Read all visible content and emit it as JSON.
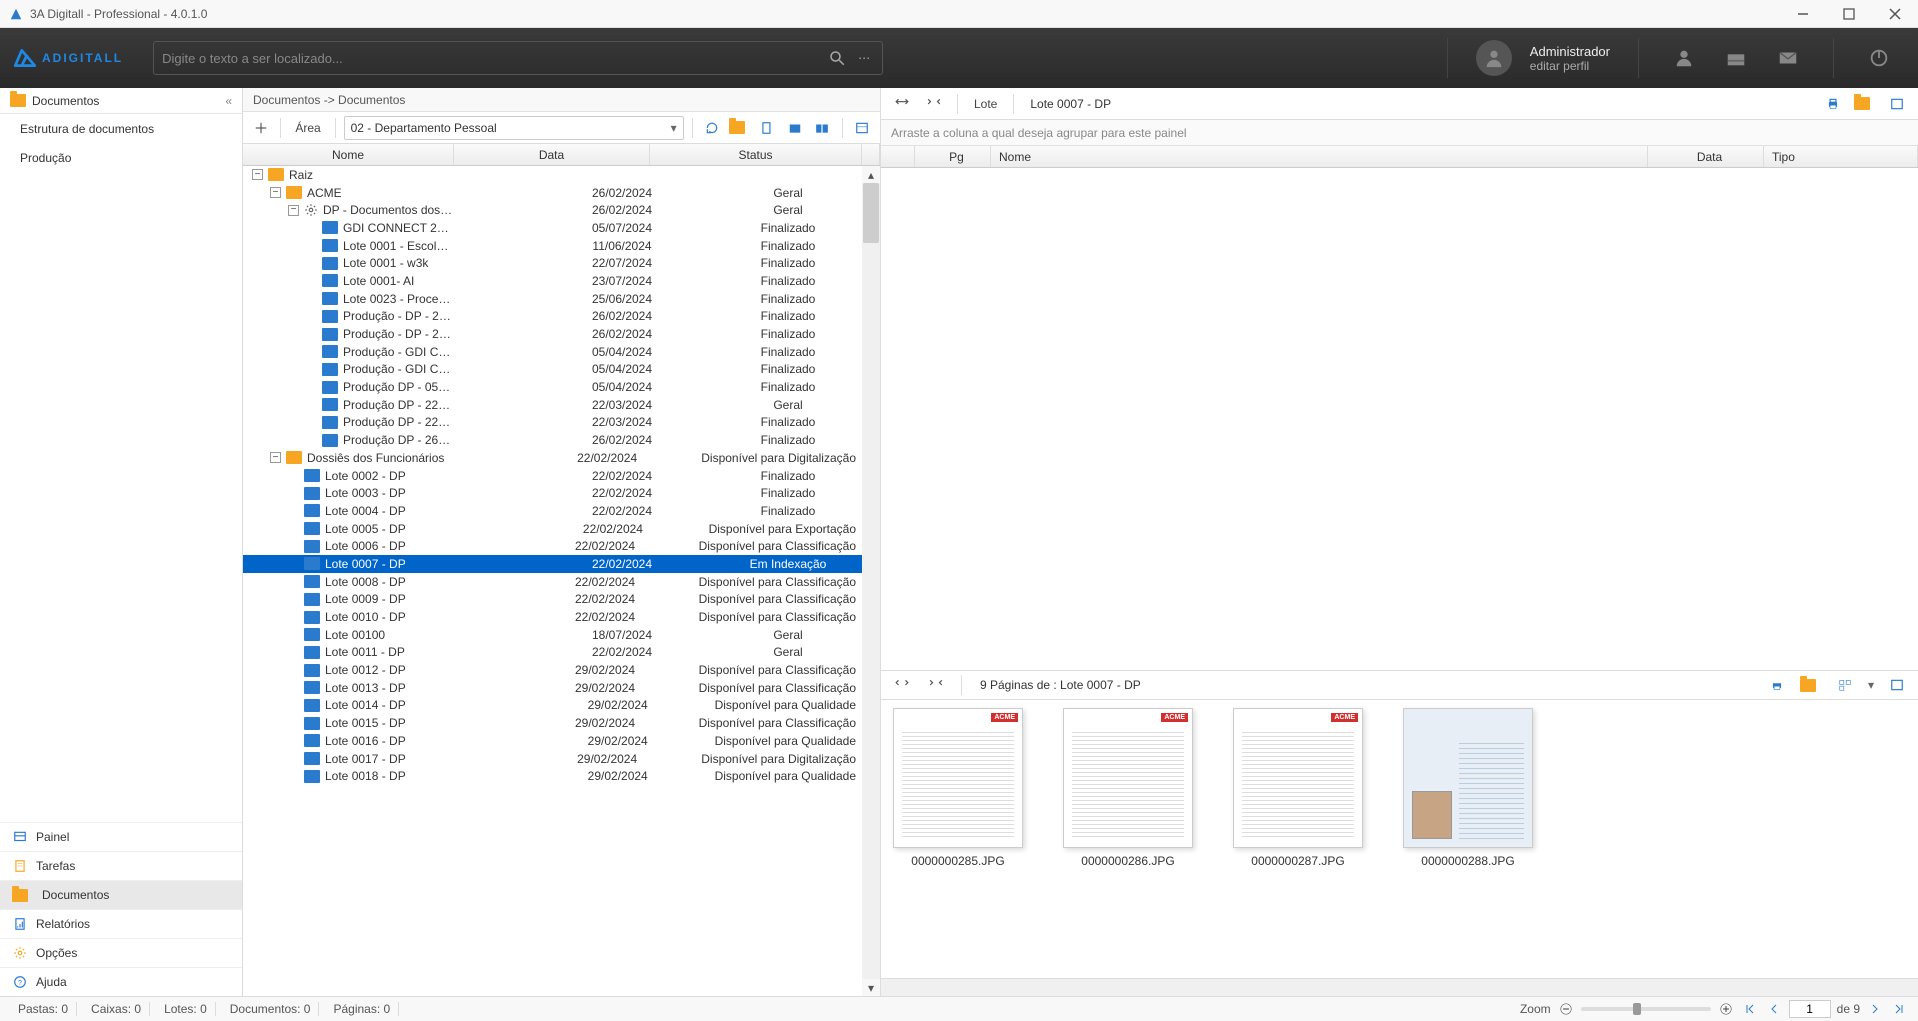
{
  "titlebar": "3A Digitall - Professional - 4.0.1.0",
  "logo": "ADIGITALL",
  "search_placeholder": "Digite o texto a ser localizado...",
  "user": {
    "name": "Administrador",
    "edit": "editar perfil"
  },
  "sidebar": {
    "header": "Documentos",
    "top_items": [
      "Estrutura de documentos",
      "Produção"
    ],
    "bottom_items": [
      {
        "label": "Painel"
      },
      {
        "label": "Tarefas"
      },
      {
        "label": "Documentos",
        "active": true
      },
      {
        "label": "Relatórios"
      },
      {
        "label": "Opções"
      },
      {
        "label": "Ajuda"
      }
    ]
  },
  "breadcrumb": "Documentos -> Documentos",
  "area_label": "Área",
  "area_selected": "02 - Departamento Pessoal",
  "tree_headers": {
    "nome": "Nome",
    "data": "Data",
    "status": "Status"
  },
  "tree_rows": [
    {
      "depth": 0,
      "exp": "-",
      "ico": "yellow",
      "nome": "Raiz",
      "data": "",
      "status": ""
    },
    {
      "depth": 1,
      "exp": "-",
      "ico": "yellow",
      "nome": "ACME",
      "data": "26/02/2024",
      "status": "Geral"
    },
    {
      "depth": 2,
      "exp": "-",
      "ico": "gear",
      "nome": "DP - Documentos dos…",
      "data": "26/02/2024",
      "status": "Geral"
    },
    {
      "depth": 3,
      "exp": "",
      "ico": "blue",
      "nome": "GDI  CONNECT 2…",
      "data": "05/07/2024",
      "status": "Finalizado"
    },
    {
      "depth": 3,
      "exp": "",
      "ico": "blue",
      "nome": "Lote 0001 - Escol…",
      "data": "11/06/2024",
      "status": "Finalizado"
    },
    {
      "depth": 3,
      "exp": "",
      "ico": "blue",
      "nome": "Lote 0001 - w3k",
      "data": "22/07/2024",
      "status": "Finalizado"
    },
    {
      "depth": 3,
      "exp": "",
      "ico": "blue",
      "nome": "Lote 0001- AI",
      "data": "23/07/2024",
      "status": "Finalizado"
    },
    {
      "depth": 3,
      "exp": "",
      "ico": "blue",
      "nome": "Lote 0023 - Proce…",
      "data": "25/06/2024",
      "status": "Finalizado"
    },
    {
      "depth": 3,
      "exp": "",
      "ico": "blue",
      "nome": "Produção - DP - 2…",
      "data": "26/02/2024",
      "status": "Finalizado"
    },
    {
      "depth": 3,
      "exp": "",
      "ico": "blue",
      "nome": "Produção - DP - 2…",
      "data": "26/02/2024",
      "status": "Finalizado"
    },
    {
      "depth": 3,
      "exp": "",
      "ico": "blue",
      "nome": "Produção - GDI C…",
      "data": "05/04/2024",
      "status": "Finalizado"
    },
    {
      "depth": 3,
      "exp": "",
      "ico": "blue",
      "nome": "Produção - GDI C…",
      "data": "05/04/2024",
      "status": "Finalizado"
    },
    {
      "depth": 3,
      "exp": "",
      "ico": "blue",
      "nome": "Produção DP - 05…",
      "data": "05/04/2024",
      "status": "Finalizado"
    },
    {
      "depth": 3,
      "exp": "",
      "ico": "blue",
      "nome": "Produção DP - 22…",
      "data": "22/03/2024",
      "status": "Geral"
    },
    {
      "depth": 3,
      "exp": "",
      "ico": "blue",
      "nome": "Produção DP - 22…",
      "data": "22/03/2024",
      "status": "Finalizado"
    },
    {
      "depth": 3,
      "exp": "",
      "ico": "blue",
      "nome": "Produção DP - 26…",
      "data": "26/02/2024",
      "status": "Finalizado"
    },
    {
      "depth": 1,
      "exp": "-",
      "ico": "yellow",
      "nome": "Dossiês dos Funcionários",
      "data": "22/02/2024",
      "status": "Disponível para Digitalização"
    },
    {
      "depth": 2,
      "exp": "",
      "ico": "blue",
      "nome": "Lote 0002 - DP",
      "data": "22/02/2024",
      "status": "Finalizado"
    },
    {
      "depth": 2,
      "exp": "",
      "ico": "blue",
      "nome": "Lote 0003 - DP",
      "data": "22/02/2024",
      "status": "Finalizado"
    },
    {
      "depth": 2,
      "exp": "",
      "ico": "blue",
      "nome": "Lote 0004 - DP",
      "data": "22/02/2024",
      "status": "Finalizado"
    },
    {
      "depth": 2,
      "exp": "",
      "ico": "blue",
      "nome": "Lote 0005 - DP",
      "data": "22/02/2024",
      "status": "Disponível para Exportação"
    },
    {
      "depth": 2,
      "exp": "",
      "ico": "blue",
      "nome": "Lote 0006 - DP",
      "data": "22/02/2024",
      "status": "Disponível para Classificação"
    },
    {
      "depth": 2,
      "exp": "",
      "ico": "blue",
      "nome": "Lote 0007 - DP",
      "data": "22/02/2024",
      "status": "Em Indexação",
      "selected": true
    },
    {
      "depth": 2,
      "exp": "",
      "ico": "blue",
      "nome": "Lote 0008 - DP",
      "data": "22/02/2024",
      "status": "Disponível para Classificação"
    },
    {
      "depth": 2,
      "exp": "",
      "ico": "blue",
      "nome": "Lote 0009 - DP",
      "data": "22/02/2024",
      "status": "Disponível para Classificação"
    },
    {
      "depth": 2,
      "exp": "",
      "ico": "blue",
      "nome": "Lote 0010 - DP",
      "data": "22/02/2024",
      "status": "Disponível para Classificação"
    },
    {
      "depth": 2,
      "exp": "",
      "ico": "blue",
      "nome": "Lote 00100",
      "data": "18/07/2024",
      "status": "Geral"
    },
    {
      "depth": 2,
      "exp": "",
      "ico": "blue",
      "nome": "Lote 0011 - DP",
      "data": "22/02/2024",
      "status": "Geral"
    },
    {
      "depth": 2,
      "exp": "",
      "ico": "blue",
      "nome": "Lote 0012 - DP",
      "data": "29/02/2024",
      "status": "Disponível para Classificação"
    },
    {
      "depth": 2,
      "exp": "",
      "ico": "blue",
      "nome": "Lote 0013 - DP",
      "data": "29/02/2024",
      "status": "Disponível para Classificação"
    },
    {
      "depth": 2,
      "exp": "",
      "ico": "blue",
      "nome": "Lote 0014 - DP",
      "data": "29/02/2024",
      "status": "Disponível para Qualidade"
    },
    {
      "depth": 2,
      "exp": "",
      "ico": "blue",
      "nome": "Lote 0015 - DP",
      "data": "29/02/2024",
      "status": "Disponível para Classificação"
    },
    {
      "depth": 2,
      "exp": "",
      "ico": "blue",
      "nome": "Lote 0016 - DP",
      "data": "29/02/2024",
      "status": "Disponível para Qualidade"
    },
    {
      "depth": 2,
      "exp": "",
      "ico": "blue",
      "nome": "Lote 0017 - DP",
      "data": "29/02/2024",
      "status": "Disponível para Digitalização"
    },
    {
      "depth": 2,
      "exp": "",
      "ico": "blue",
      "nome": "Lote 0018 - DP",
      "data": "29/02/2024",
      "status": "Disponível para Qualidade"
    }
  ],
  "right": {
    "lote_label": "Lote",
    "lote_value": "Lote 0007 - DP",
    "group_hint": "Arraste a coluna a qual deseja agrupar para este painel",
    "headers": {
      "pg": "Pg",
      "nome": "Nome",
      "data": "Data",
      "tipo": "Tipo"
    },
    "docs_title": "9 Páginas de : Lote 0007 - DP",
    "thumbs": [
      {
        "cap": "0000000285.JPG",
        "kind": "doc"
      },
      {
        "cap": "0000000286.JPG",
        "kind": "doc"
      },
      {
        "cap": "0000000287.JPG",
        "kind": "doc"
      },
      {
        "cap": "0000000288.JPG",
        "kind": "id"
      }
    ]
  },
  "statusbar": {
    "pastas": "Pastas: 0",
    "caixas": "Caixas: 0",
    "lotes": "Lotes: 0",
    "documentos": "Documentos: 0",
    "paginas": "Páginas: 0",
    "zoom_label": "Zoom",
    "page_current": "1",
    "page_total": "de 9"
  }
}
